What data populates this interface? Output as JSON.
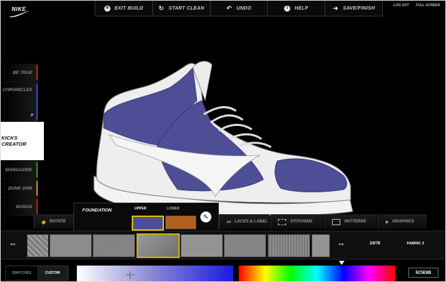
{
  "brand": {
    "logo": "NIKE"
  },
  "topbar": [
    {
      "label": "EXIT BUILD",
      "icon": "close-circle-icon"
    },
    {
      "label": "START CLEAN",
      "icon": "refresh-icon"
    },
    {
      "label": "UNDO",
      "icon": "undo-icon"
    },
    {
      "label": "HELP",
      "icon": "info-icon"
    },
    {
      "label": "SAVE/FINISH",
      "icon": "arrow-right-icon"
    }
  ],
  "toplinks": {
    "logout": "LOG OUT",
    "fullscreen": "FULL SCREEN"
  },
  "left_menu": [
    {
      "label": "BE TRUE",
      "color": "#cc1f1f"
    },
    {
      "label": "CHRONICLES",
      "color": "#2b4fd0"
    },
    {
      "label": "KICKS CREATOR",
      "color": "#ffffff"
    },
    {
      "label": "MANGAZINE",
      "color": "#2f9b2f"
    },
    {
      "label": "DUNK 2008",
      "color": "#d08b1f"
    },
    {
      "label": "BONUS",
      "color": "#c21a1a"
    }
  ],
  "foundation": {
    "label": "FOUNDATION",
    "upper": {
      "label": "UPPER",
      "color": "#4d4e95"
    },
    "lower": {
      "label": "LOWER",
      "color": "#b3601f"
    }
  },
  "tabs": {
    "rotate": "ROTATE",
    "laces": "LACES & LABEL",
    "stitching": "STITCHING",
    "patterns": "PATTERNS",
    "graphics": "GRAPHICS"
  },
  "swatches": {
    "count": "24/78",
    "fabric_name": "FABRIC 3"
  },
  "color_picker": {
    "tab_swatches": "SWATCHES",
    "tab_custom": "CUSTOM",
    "hex": "5C5E8B",
    "selected_color": "#5c5e8b"
  }
}
